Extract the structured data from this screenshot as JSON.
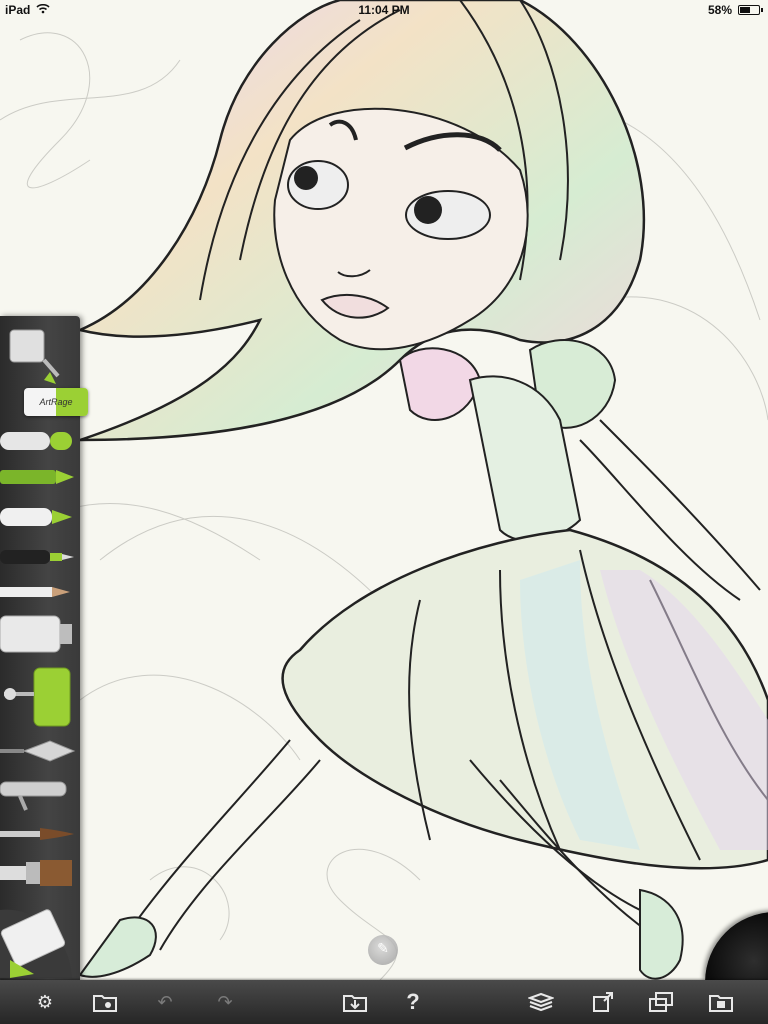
{
  "status_bar": {
    "device": "iPad",
    "time": "11:04 PM",
    "battery_percent": "58%",
    "battery_level": 0.58,
    "wifi_icon": "wifi-icon",
    "battery_icon": "battery-icon"
  },
  "brand": {
    "logo_text": "ArtRage"
  },
  "tools": [
    {
      "name": "paint-tube-picker",
      "icon": "paint-bucket-icon"
    },
    {
      "name": "pencil-color",
      "icon": "marker-icon"
    },
    {
      "name": "crayon",
      "icon": "crayon-icon"
    },
    {
      "name": "felt-pen",
      "icon": "felt-pen-icon"
    },
    {
      "name": "ink-pen",
      "icon": "ink-pen-icon"
    },
    {
      "name": "pencil",
      "icon": "pencil-icon"
    },
    {
      "name": "paint-tube",
      "icon": "paint-tube-icon"
    },
    {
      "name": "paint-roller",
      "icon": "roller-icon"
    },
    {
      "name": "palette-knife",
      "icon": "palette-knife-icon"
    },
    {
      "name": "airbrush",
      "icon": "airbrush-icon"
    },
    {
      "name": "fine-brush",
      "icon": "fine-brush-icon"
    },
    {
      "name": "flat-brush",
      "icon": "flat-brush-icon"
    },
    {
      "name": "eraser",
      "icon": "eraser-icon"
    }
  ],
  "colors": {
    "accent": "#9bd034",
    "toolbar": "#333333",
    "current_color": "#111111"
  },
  "toolbar": {
    "settings": "gear-icon",
    "gallery": "gallery-folder-icon",
    "undo": "undo-icon",
    "redo": "redo-icon",
    "import": "import-folder-icon",
    "help": "?",
    "layers": "layers-icon",
    "share": "share-icon",
    "canvas_resize": "canvas-icon",
    "save": "save-folder-icon"
  }
}
